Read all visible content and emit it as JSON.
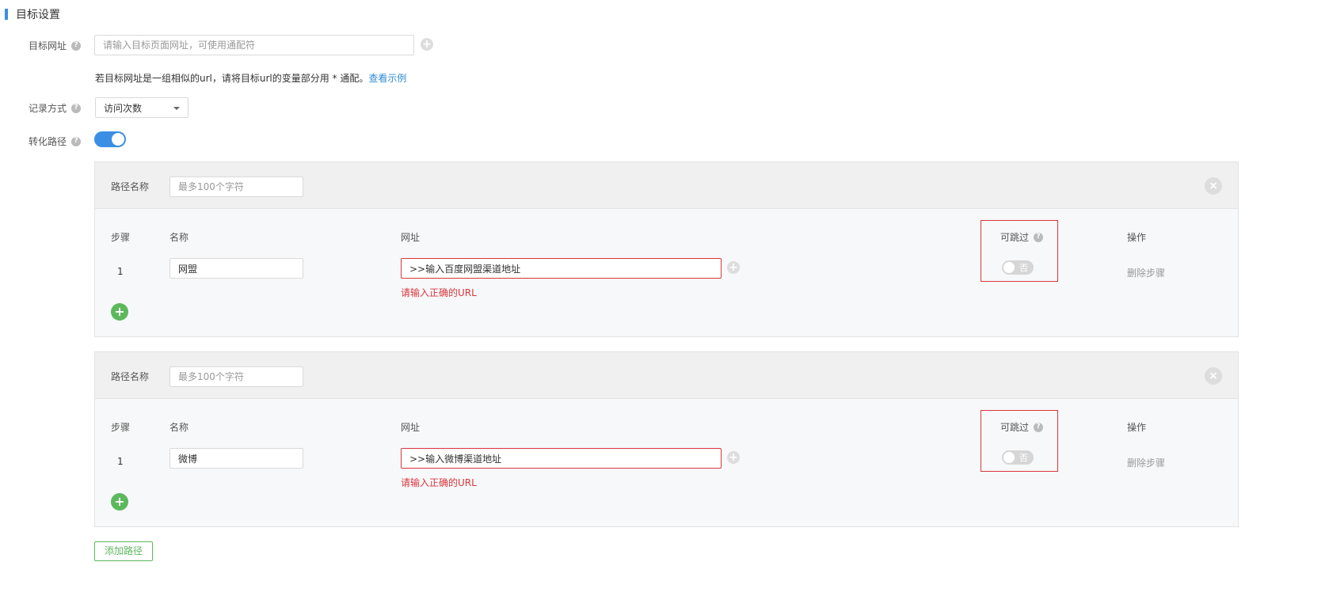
{
  "section": {
    "title": "目标设置"
  },
  "target_url": {
    "label": "目标网址",
    "placeholder": "请输入目标页面网址，可使用通配符",
    "hint_text": "若目标网址是一组相似的url，请将目标url的变量部分用 * 通配。",
    "hint_link": "查看示例"
  },
  "record_method": {
    "label": "记录方式",
    "value": "访问次数"
  },
  "conversion_path": {
    "label": "转化路径",
    "enabled": true
  },
  "paths": [
    {
      "name_label": "路径名称",
      "name_placeholder": "最多100个字符",
      "columns": {
        "step": "步骤",
        "name": "名称",
        "url": "网址",
        "skippable": "可跳过",
        "action": "操作"
      },
      "steps": [
        {
          "num": "1",
          "name": "网盟",
          "url": ">>输入百度网盟渠道地址",
          "error": "请输入正确的URL",
          "skip": "否",
          "delete": "删除步骤"
        }
      ]
    },
    {
      "name_label": "路径名称",
      "name_placeholder": "最多100个字符",
      "columns": {
        "step": "步骤",
        "name": "名称",
        "url": "网址",
        "skippable": "可跳过",
        "action": "操作"
      },
      "steps": [
        {
          "num": "1",
          "name": "微博",
          "url": ">>输入微博渠道地址",
          "error": "请输入正确的URL",
          "skip": "否",
          "delete": "删除步骤"
        }
      ]
    }
  ],
  "add_path_button": "添加路径",
  "colors": {
    "accent": "#3a8ee6",
    "error": "#d9363e",
    "success": "#5cb85c",
    "link": "#2f8bd6"
  },
  "icons": {
    "help": "question-circle-icon",
    "plus": "plus-circle-icon",
    "close": "close-circle-icon",
    "caret": "caret-down-icon"
  }
}
